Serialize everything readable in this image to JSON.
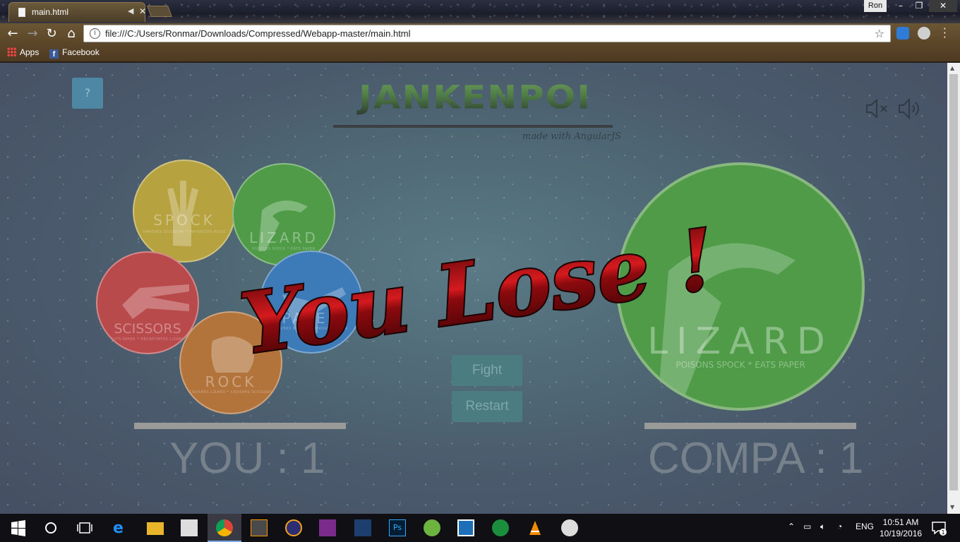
{
  "browser": {
    "tab_title": "main.html",
    "profile_name": "Ron",
    "url": "file:///C:/Users/Ronmar/Downloads/Compressed/Webapp-master/main.html",
    "bookmarks": [
      "Apps",
      "Facebook"
    ]
  },
  "game": {
    "help_label": "?",
    "title": "JANKENPOI",
    "subtitle": "made with AngularJS",
    "choices": [
      {
        "name": "SPOCK",
        "desc": "SMASHES SCISSORS * VAPORIZES ROCK"
      },
      {
        "name": "LIZARD",
        "desc": "POISONS SPOCK * EATS PAPER"
      },
      {
        "name": "PAPER",
        "desc": "COVERS ROCK * DISPROVES SPOCK"
      },
      {
        "name": "SCISSORS",
        "desc": "CUTS PAPER * DECAPITATES LIZARD"
      },
      {
        "name": "ROCK",
        "desc": "CRUSHES LIZARD * CRUSHES SCISSORS"
      }
    ],
    "computer_choice": {
      "name": "LIZARD",
      "desc": "POISONS SPOCK * EATS PAPER"
    },
    "fight_label": "Fight",
    "restart_label": "Restart",
    "player_score": "YOU : 1",
    "computer_score": "COMPA : 1",
    "result": "You Lose !"
  },
  "taskbar": {
    "language": "ENG",
    "time": "10:51 AM",
    "date": "10/19/2016",
    "notification_count": "1"
  }
}
